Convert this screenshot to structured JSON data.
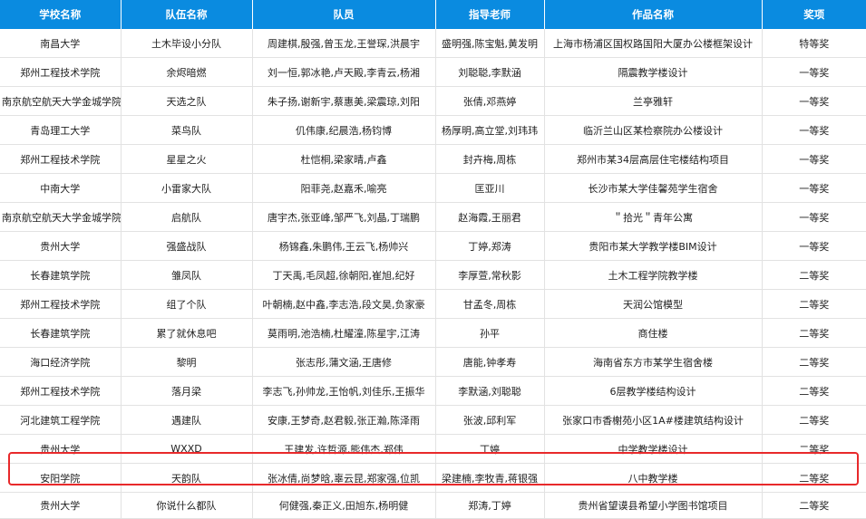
{
  "header": {
    "school": "学校名称",
    "team": "队伍名称",
    "members": "队员",
    "advisor": "指导老师",
    "work": "作品名称",
    "award": "奖项"
  },
  "highlight_row_index": 15,
  "colors": {
    "header_bg": "#0a8be0",
    "highlight_border": "#e8292b"
  },
  "rows": [
    {
      "school": "南昌大学",
      "team": "土木毕设小分队",
      "members": "周建棋,殷强,曾玉龙,王誉琛,洪晨宇",
      "advisor": "盛明强,陈宝魁,黄发明",
      "work": "上海市杨浦区国权路国阳大厦办公楼框架设计",
      "award": "特等奖"
    },
    {
      "school": "郑州工程技术学院",
      "team": "余烬暗燃",
      "members": "刘一恒,郭冰艳,卢天殿,李青云,杨湘",
      "advisor": "刘聪聪,李默涵",
      "work": "隔震教学楼设计",
      "award": "一等奖"
    },
    {
      "school": "南京航空航天大学金城学院",
      "team": "天选之队",
      "members": "朱子扬,谢新宇,蔡惠美,梁震琼,刘阳",
      "advisor": "张倩,邓燕婷",
      "work": "兰亭雅轩",
      "award": "一等奖"
    },
    {
      "school": "青岛理工大学",
      "team": "菜鸟队",
      "members": "仉伟康,纪晨浩,杨钧博",
      "advisor": "杨厚明,高立堂,刘玮玮",
      "work": "临沂兰山区某检察院办公楼设计",
      "award": "一等奖"
    },
    {
      "school": "郑州工程技术学院",
      "team": "星星之火",
      "members": "杜恺桐,梁家晴,卢鑫",
      "advisor": "封卉梅,周栋",
      "work": "郑州市某34层高层住宅楼结构项目",
      "award": "一等奖"
    },
    {
      "school": "中南大学",
      "team": "小雷家大队",
      "members": "阳菲尧,赵嘉禾,喻亮",
      "advisor": "匡亚川",
      "work": "长沙市某大学佳馨苑学生宿舍",
      "award": "一等奖"
    },
    {
      "school": "南京航空航天大学金城学院",
      "team": "启航队",
      "members": "唐宇杰,张亚峰,邹严飞,刘晶,丁瑞鹏",
      "advisor": "赵海霞,王丽君",
      "work": "＂拾光＂青年公寓",
      "award": "一等奖"
    },
    {
      "school": "贵州大学",
      "team": "强盛战队",
      "members": "杨锦鑫,朱鹏伟,王云飞,杨帅兴",
      "advisor": "丁婷,郑涛",
      "work": "贵阳市某大学教学楼BIM设计",
      "award": "一等奖"
    },
    {
      "school": "长春建筑学院",
      "team": "雏凤队",
      "members": "丁天禹,毛凤超,徐朝阳,崔旭,纪好",
      "advisor": "李厚萱,常秋影",
      "work": "土木工程学院教学楼",
      "award": "二等奖"
    },
    {
      "school": "郑州工程技术学院",
      "team": "组了个队",
      "members": "叶朝楠,赵中鑫,李志浩,段文昊,负家豪",
      "advisor": "甘孟冬,周栋",
      "work": "天润公馆模型",
      "award": "二等奖"
    },
    {
      "school": "长春建筑学院",
      "team": "累了就休息吧",
      "members": "莫雨明,池浩楠,杜耀潼,陈星宇,江涛",
      "advisor": "孙平",
      "work": "商住楼",
      "award": "二等奖"
    },
    {
      "school": "海口经济学院",
      "team": "黎明",
      "members": "张志彤,蒲文涵,王唐修",
      "advisor": "唐能,钟孝寿",
      "work": "海南省东方市某学生宿舍楼",
      "award": "二等奖"
    },
    {
      "school": "郑州工程技术学院",
      "team": "落月梁",
      "members": "李志飞,孙帅龙,王怡帆,刘佳乐,王振华",
      "advisor": "李默涵,刘聪聪",
      "work": "6层教学楼结构设计",
      "award": "二等奖"
    },
    {
      "school": "河北建筑工程学院",
      "team": "遇建队",
      "members": "安康,王梦奇,赵君毅,张正瀚,陈泽雨",
      "advisor": "张波,邱利军",
      "work": "张家口市香榭苑小区1A#楼建筑结构设计",
      "award": "二等奖"
    },
    {
      "school": "贵州大学",
      "team": "WXXD",
      "members": "王建发,许哲源,熊伟杰,郑伟",
      "advisor": "丁婷",
      "work": "中学教学楼设计",
      "award": "二等奖"
    },
    {
      "school": "安阳学院",
      "team": "天韵队",
      "members": "张冰倩,尚梦晗,辜云昆,郑家强,位凯",
      "advisor": "梁建楠,李牧青,蒋银强",
      "work": "八中教学楼",
      "award": "二等奖"
    },
    {
      "school": "贵州大学",
      "team": "你说什么都队",
      "members": "何健强,秦正义,田旭东,杨明健",
      "advisor": "郑涛,丁婷",
      "work": "贵州省望谟县希望小学图书馆项目",
      "award": "二等奖"
    }
  ]
}
